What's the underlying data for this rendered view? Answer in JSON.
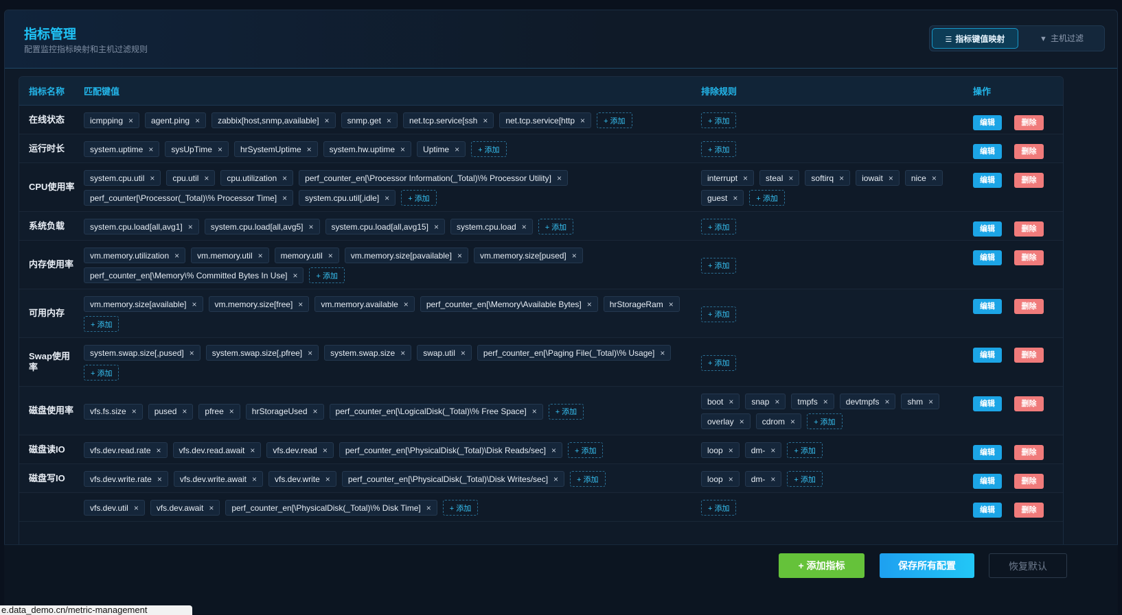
{
  "header": {
    "title": "指标管理",
    "subtitle": "配置监控指标映射和主机过滤规则",
    "tabs": [
      {
        "label": "指标键值映射",
        "icon": "list-icon",
        "active": true
      },
      {
        "label": "主机过滤",
        "icon": "filter-icon",
        "active": false
      }
    ]
  },
  "table": {
    "columns": {
      "name": "指标名称",
      "keys": "匹配键值",
      "exclude": "排除规则",
      "ops": "操作"
    },
    "add_label": "+ 添加",
    "edit_label": "编辑",
    "delete_label": "删除",
    "rows": [
      {
        "name": "在线状态",
        "keys": [
          "icmpping",
          "agent.ping",
          "zabbix[host,snmp,available]",
          "snmp.get",
          "net.tcp.service[ssh",
          "net.tcp.service[http"
        ],
        "exclude": []
      },
      {
        "name": "运行时长",
        "keys": [
          "system.uptime",
          "sysUpTime",
          "hrSystemUptime",
          "system.hw.uptime",
          "Uptime"
        ],
        "exclude": []
      },
      {
        "name": "CPU使用率",
        "keys": [
          "system.cpu.util",
          "cpu.util",
          "cpu.utilization",
          "perf_counter_en[\\Processor Information(_Total)\\% Processor Utility]",
          "perf_counter[\\Processor(_Total)\\% Processor Time]",
          "system.cpu.util[,idle]"
        ],
        "exclude": [
          "interrupt",
          "steal",
          "softirq",
          "iowait",
          "nice",
          "guest"
        ]
      },
      {
        "name": "系统负载",
        "keys": [
          "system.cpu.load[all,avg1]",
          "system.cpu.load[all,avg5]",
          "system.cpu.load[all,avg15]",
          "system.cpu.load"
        ],
        "exclude": []
      },
      {
        "name": "内存使用率",
        "keys": [
          "vm.memory.utilization",
          "vm.memory.util",
          "memory.util",
          "vm.memory.size[pavailable]",
          "vm.memory.size[pused]",
          "perf_counter_en[\\Memory\\% Committed Bytes In Use]"
        ],
        "exclude": []
      },
      {
        "name": "可用内存",
        "keys": [
          "vm.memory.size[available]",
          "vm.memory.size[free]",
          "vm.memory.available",
          "perf_counter_en[\\Memory\\Available Bytes]",
          "hrStorageRam"
        ],
        "exclude": []
      },
      {
        "name": "Swap使用率",
        "keys": [
          "system.swap.size[,pused]",
          "system.swap.size[,pfree]",
          "system.swap.size",
          "swap.util",
          "perf_counter_en[\\Paging File(_Total)\\% Usage]"
        ],
        "exclude": []
      },
      {
        "name": "磁盘使用率",
        "keys": [
          "vfs.fs.size",
          "pused",
          "pfree",
          "hrStorageUsed",
          "perf_counter_en[\\LogicalDisk(_Total)\\% Free Space]"
        ],
        "exclude": [
          "boot",
          "snap",
          "tmpfs",
          "devtmpfs",
          "shm",
          "overlay",
          "cdrom"
        ]
      },
      {
        "name": "磁盘读IO",
        "keys": [
          "vfs.dev.read.rate",
          "vfs.dev.read.await",
          "vfs.dev.read",
          "perf_counter_en[\\PhysicalDisk(_Total)\\Disk Reads/sec]"
        ],
        "exclude": [
          "loop",
          "dm-"
        ]
      },
      {
        "name": "磁盘写IO",
        "keys": [
          "vfs.dev.write.rate",
          "vfs.dev.write.await",
          "vfs.dev.write",
          "perf_counter_en[\\PhysicalDisk(_Total)\\Disk Writes/sec]"
        ],
        "exclude": [
          "loop",
          "dm-"
        ]
      },
      {
        "name": "",
        "keys": [
          "vfs.dev.util",
          "vfs.dev.await",
          "perf_counter_en[\\PhysicalDisk(_Total)\\% Disk Time]"
        ],
        "exclude": []
      }
    ]
  },
  "footer": {
    "add_metric": "+ 添加指标",
    "save_all": "保存所有配置",
    "reset": "恢复默认"
  },
  "status_url": "e.data_demo.cn/metric-management"
}
